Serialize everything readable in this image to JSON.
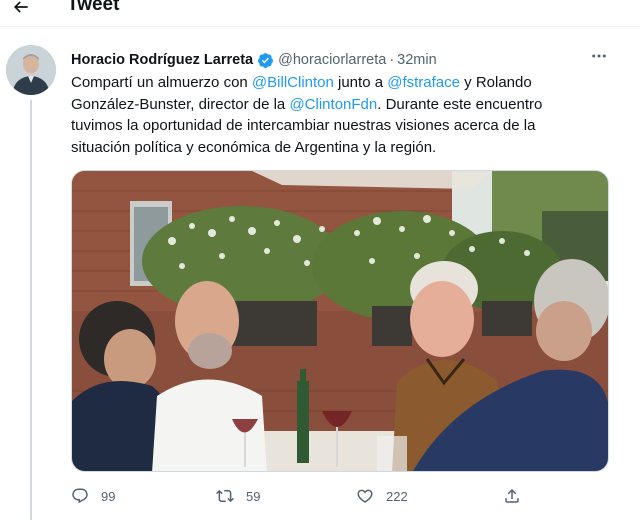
{
  "header": {
    "title": "Tweet",
    "back_icon": "arrow-left-icon"
  },
  "tweet": {
    "author": {
      "display_name": "Horacio Rodríguez Larreta",
      "verified": true,
      "handle": "@horaciorlarreta",
      "separator": "·",
      "time": "32min"
    },
    "more_icon": "more-horizontal-icon",
    "text": {
      "part1": "Compartí un almuerzo con ",
      "mention1": "@BillClinton",
      "part2": " junto a ",
      "mention2": "@fstraface",
      "part3": " y Rolando González-Bunster, director de la ",
      "mention3": "@ClintonFdn",
      "part4": ". Durante este encuentro tuvimos la oportunidad de intercambiar nuestras visiones acerca de la situación política y económica de Argentina y la región."
    },
    "media": {
      "type": "photo",
      "icon": "photo-lunch-meeting"
    },
    "actions": {
      "reply": {
        "icon": "reply-icon",
        "count": "99"
      },
      "retweet": {
        "icon": "retweet-icon",
        "count": "59"
      },
      "like": {
        "icon": "heart-icon",
        "count": "222"
      },
      "share": {
        "icon": "share-icon"
      }
    }
  },
  "colors": {
    "accent": "#1d9bf0",
    "text": "#0f1419",
    "secondary": "#536471",
    "border": "#cfd9de"
  }
}
